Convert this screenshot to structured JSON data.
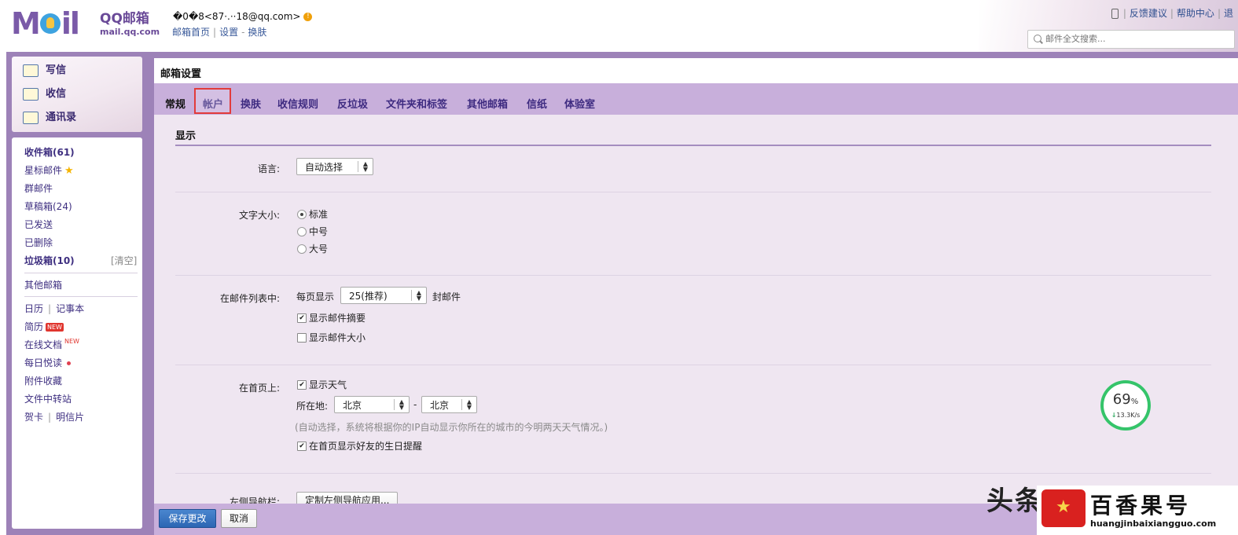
{
  "header": {
    "logo_text": "M  il",
    "logo_cn": "QQ邮箱",
    "logo_en": "mail.qq.com",
    "account": "�0�8<87·.··18@qq.com>",
    "nav": [
      "邮箱首页",
      "设置",
      "换肤"
    ],
    "top_links": [
      "反馈建议",
      "帮助中心",
      "退"
    ],
    "search_placeholder": "邮件全文搜索..."
  },
  "quick_actions": [
    {
      "label": "写信",
      "icon": "compose-icon"
    },
    {
      "label": "收信",
      "icon": "inbox-download-icon"
    },
    {
      "label": "通讯录",
      "icon": "contacts-icon"
    }
  ],
  "folders": {
    "inbox": "收件箱(61)",
    "starred": "星标邮件",
    "group": "群邮件",
    "drafts": "草稿箱(24)",
    "sent": "已发送",
    "deleted": "已删除",
    "spam": "垃圾箱(10)",
    "spam_clear": "[清空]",
    "other_mail": "其他邮箱",
    "calendar": "日历",
    "notes": "记事本",
    "resume": "简历",
    "new_badge": "NEW",
    "online_docs": "在线文档",
    "daily_read": "每日悦读",
    "attachments": "附件收藏",
    "file_transfer": "文件中转站",
    "cards": "贺卡",
    "postcards": "明信片"
  },
  "main": {
    "title": "邮箱设置",
    "tabs": [
      "常规",
      "帐户",
      "换肤",
      "收信规则",
      "反垃圾",
      "文件夹和标签",
      "其他邮箱",
      "信纸",
      "体验室"
    ],
    "section": "显示",
    "language": {
      "label": "语言:",
      "value": "自动选择"
    },
    "font_size": {
      "label": "文字大小:",
      "options": [
        "标准",
        "中号",
        "大号"
      ],
      "selected": "标准"
    },
    "mail_list": {
      "label": "在邮件列表中:",
      "per_page_prefix": "每页显示",
      "per_page_value": "25(推荐)",
      "per_page_suffix": "封邮件",
      "show_summary": "显示邮件摘要",
      "show_summary_checked": true,
      "show_size": "显示邮件大小",
      "show_size_checked": false
    },
    "home": {
      "label": "在首页上:",
      "show_weather": "显示天气",
      "show_weather_checked": true,
      "location_label": "所在地:",
      "province": "北京",
      "dash": "-",
      "city": "北京",
      "hint": "(自动选择，系统将根据你的IP自动显示你所在的城市的今明两天天气情况。)",
      "birthday": "在首页显示好友的生日提醒",
      "birthday_checked": true
    },
    "left_nav": {
      "label": "左侧导航栏:",
      "button": "定制左侧导航应用..."
    }
  },
  "footer": {
    "save": "保存更改",
    "cancel": "取消"
  },
  "speed_widget": {
    "percent": "69",
    "unit": "%",
    "rate": "13.3K/s"
  },
  "watermark": {
    "toutiao": "头条",
    "title": "百香果号",
    "url": "huangjinbaixiangguo.com"
  }
}
